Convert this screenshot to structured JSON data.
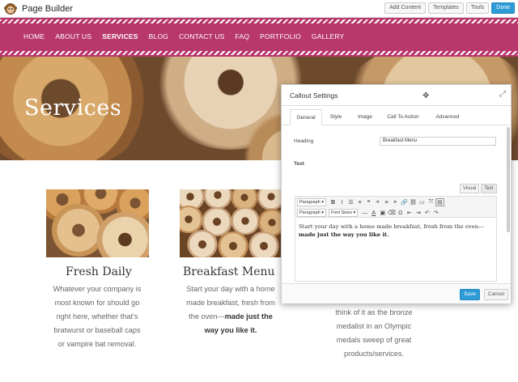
{
  "app": {
    "title": "Page Builder"
  },
  "toolbar": {
    "add_content": "Add Content",
    "templates": "Templates",
    "tools": "Tools",
    "done": "Done",
    "accent": "#2e9bd6"
  },
  "nav": {
    "items": [
      "HOME",
      "ABOUT US",
      "SERVICES",
      "BLOG",
      "CONTACT US",
      "FAQ",
      "PORTFOLIO",
      "GALLERY"
    ],
    "active": "SERVICES",
    "color": "#b8386b"
  },
  "hero": {
    "title": "Services"
  },
  "cards": [
    {
      "title": "Fresh Daily",
      "lines": [
        "Whatever your company is",
        "most known for should go",
        "right here, whether that's",
        "bratwurst or baseball caps",
        "or vampire bat removal."
      ]
    },
    {
      "title": "Breakfast Menu",
      "lines": [
        "Start your day with a home",
        "made breakfast, fresh from",
        "the oven---"
      ],
      "bold_lines": [
        "made just the",
        "way you like it."
      ]
    },
    {
      "lines": [
        "think of it as the bronze",
        "medalist in an Olympic",
        "medals sweep of great",
        "products/services."
      ]
    }
  ],
  "dialog": {
    "title": "Callout Settings",
    "tabs": [
      "General",
      "Style",
      "Image",
      "Call To Action",
      "Advanced"
    ],
    "active_tab": "General",
    "heading_label": "Heading",
    "heading_value": "Breakfast Menu",
    "text_label": "Text",
    "visual_label": "Visual",
    "text_tab_label": "Text",
    "format_select": "Paragraph",
    "format_select_2": "Paragraph",
    "font_sizes": "Font Sizes",
    "editor_text": "Start your day with a home made breakfast, fresh from the oven---",
    "editor_bold": "made just the way you like it.",
    "save": "Save",
    "cancel": "Cancel"
  }
}
